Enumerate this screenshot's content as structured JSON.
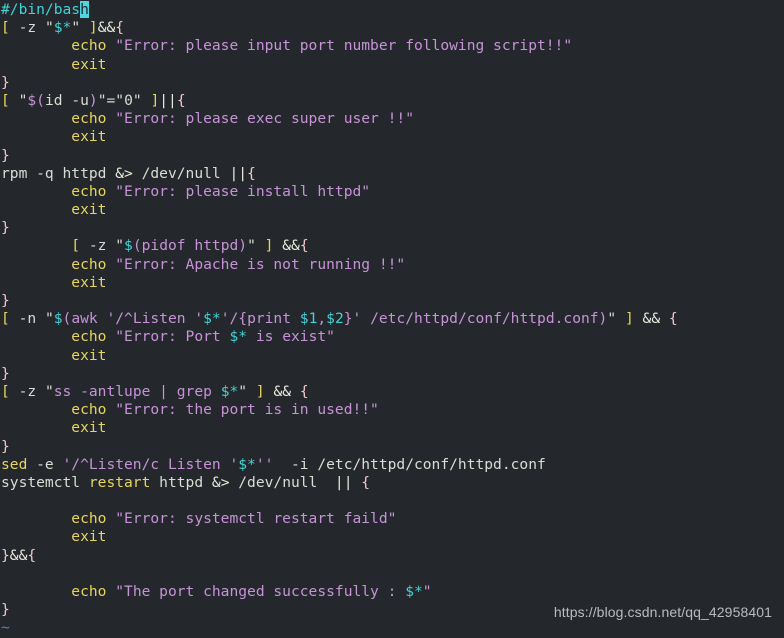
{
  "app": {
    "type": "terminal-text-editor",
    "background_color": "#24282c",
    "foreground_color": "#d8d8d2",
    "font": "monospace",
    "cursor_char": "h",
    "cursor_color": "#4fd6e0"
  },
  "palette": {
    "comment": "#3fd3d6",
    "bracket": "#e7d65b",
    "keyword": "#e7d65b",
    "string": "#c792d8",
    "variable": "#3fd3d6",
    "brace": "#f3c6c6",
    "operator": "#eceade",
    "plain": "#dcdcd4",
    "tilde": "#5a7fc4",
    "watermark": "#b9bcbe"
  },
  "watermark": {
    "text": "https://blog.csdn.net/qq_42958401"
  },
  "script": {
    "language": "bash",
    "raw_lines": [
      "#/bin/bash",
      "[ -z \"$*\" ]&&{",
      "        echo \"Error: please input port number following script!!\"",
      "        exit",
      "}",
      "[ \"$(id -u)\"=\"0\" ]||{",
      "        echo \"Error: please exec super user !!\"",
      "        exit",
      "}",
      "rpm -q httpd &> /dev/null ||{",
      "        echo \"Error: please install httpd\"",
      "        exit",
      "}",
      "        [ -z \"$(pidof httpd)\" ] &&{",
      "        echo \"Error: Apache is not running !!\"",
      "        exit",
      "}",
      "[ -n \"$(awk '/^Listen '$*'/{print $1,$2}' /etc/httpd/conf/httpd.conf)\" ] && {",
      "        echo \"Error: Port $* is exist\"",
      "        exit",
      "}",
      "[ -z \"ss -antlupe | grep $*\" ] && {",
      "        echo \"Error: the port is in used!!\"",
      "        exit",
      "}",
      "sed -e '/^Listen/c Listen '$*''  -i /etc/httpd/conf/httpd.conf",
      "systemctl restart httpd &> /dev/null  || {",
      "",
      "        echo \"Error: systemctl restart faild\"",
      "        exit",
      "}&&{",
      "",
      "        echo \"The port changed successfully : $*\"",
      "}",
      "~"
    ],
    "lines": [
      {
        "id": 1,
        "tokens": [
          {
            "t": "#/bin/bas",
            "c": "comment"
          },
          {
            "t": "h",
            "c": "cursor"
          }
        ]
      },
      {
        "id": 2,
        "tokens": [
          {
            "t": "[",
            "c": "bracket"
          },
          {
            "t": " -z ",
            "c": "plain"
          },
          {
            "t": "\"",
            "c": "quote"
          },
          {
            "t": "$*",
            "c": "var"
          },
          {
            "t": "\"",
            "c": "quote"
          },
          {
            "t": " ",
            "c": "plain"
          },
          {
            "t": "]",
            "c": "bracket"
          },
          {
            "t": "&&",
            "c": "op"
          },
          {
            "t": "{",
            "c": "brace"
          }
        ]
      },
      {
        "id": 3,
        "tokens": [
          {
            "t": "        ",
            "c": "plain"
          },
          {
            "t": "echo",
            "c": "keyword"
          },
          {
            "t": " ",
            "c": "plain"
          },
          {
            "t": "\"Error: please input port number following script!!\"",
            "c": "string"
          }
        ]
      },
      {
        "id": 4,
        "tokens": [
          {
            "t": "        ",
            "c": "plain"
          },
          {
            "t": "exit",
            "c": "keyword"
          }
        ]
      },
      {
        "id": 5,
        "tokens": [
          {
            "t": "}",
            "c": "brace"
          }
        ]
      },
      {
        "id": 6,
        "tokens": [
          {
            "t": "[",
            "c": "bracket"
          },
          {
            "t": " ",
            "c": "plain"
          },
          {
            "t": "\"",
            "c": "quote"
          },
          {
            "t": "$(",
            "c": "varm"
          },
          {
            "t": "id -u",
            "c": "plain"
          },
          {
            "t": ")",
            "c": "varm"
          },
          {
            "t": "\"",
            "c": "quote"
          },
          {
            "t": "=",
            "c": "plain"
          },
          {
            "t": "\"0\"",
            "c": "quote"
          },
          {
            "t": " ",
            "c": "plain"
          },
          {
            "t": "]",
            "c": "bracket"
          },
          {
            "t": "||",
            "c": "op"
          },
          {
            "t": "{",
            "c": "brace"
          }
        ]
      },
      {
        "id": 7,
        "tokens": [
          {
            "t": "        ",
            "c": "plain"
          },
          {
            "t": "echo",
            "c": "keyword"
          },
          {
            "t": " ",
            "c": "plain"
          },
          {
            "t": "\"Error: please exec super user !!\"",
            "c": "string"
          }
        ]
      },
      {
        "id": 8,
        "tokens": [
          {
            "t": "        ",
            "c": "plain"
          },
          {
            "t": "exit",
            "c": "keyword"
          }
        ]
      },
      {
        "id": 9,
        "tokens": [
          {
            "t": "}",
            "c": "brace"
          }
        ]
      },
      {
        "id": 10,
        "tokens": [
          {
            "t": "rpm -q httpd ",
            "c": "plain"
          },
          {
            "t": "&>",
            "c": "op"
          },
          {
            "t": " /dev/null ",
            "c": "plain"
          },
          {
            "t": "||",
            "c": "op"
          },
          {
            "t": "{",
            "c": "brace"
          }
        ]
      },
      {
        "id": 11,
        "tokens": [
          {
            "t": "        ",
            "c": "plain"
          },
          {
            "t": "echo",
            "c": "keyword"
          },
          {
            "t": " ",
            "c": "plain"
          },
          {
            "t": "\"Error: please install httpd\"",
            "c": "string"
          }
        ]
      },
      {
        "id": 12,
        "tokens": [
          {
            "t": "        ",
            "c": "plain"
          },
          {
            "t": "exit",
            "c": "keyword"
          }
        ]
      },
      {
        "id": 13,
        "tokens": [
          {
            "t": "}",
            "c": "brace"
          }
        ]
      },
      {
        "id": 14,
        "tokens": [
          {
            "t": "        ",
            "c": "plain"
          },
          {
            "t": "[",
            "c": "bracket"
          },
          {
            "t": " -z ",
            "c": "plain"
          },
          {
            "t": "\"",
            "c": "quote"
          },
          {
            "t": "$",
            "c": "var"
          },
          {
            "t": "(pidof httpd)",
            "c": "string"
          },
          {
            "t": "\"",
            "c": "quote"
          },
          {
            "t": " ",
            "c": "plain"
          },
          {
            "t": "]",
            "c": "bracket"
          },
          {
            "t": " ",
            "c": "plain"
          },
          {
            "t": "&&",
            "c": "op"
          },
          {
            "t": "{",
            "c": "brace"
          }
        ]
      },
      {
        "id": 15,
        "tokens": [
          {
            "t": "        ",
            "c": "plain"
          },
          {
            "t": "echo",
            "c": "keyword"
          },
          {
            "t": " ",
            "c": "plain"
          },
          {
            "t": "\"Error: Apache is not running !!\"",
            "c": "string"
          }
        ]
      },
      {
        "id": 16,
        "tokens": [
          {
            "t": "        ",
            "c": "plain"
          },
          {
            "t": "exit",
            "c": "keyword"
          }
        ]
      },
      {
        "id": 17,
        "tokens": [
          {
            "t": "}",
            "c": "brace"
          }
        ]
      },
      {
        "id": 18,
        "tokens": [
          {
            "t": "[",
            "c": "bracket"
          },
          {
            "t": " -n ",
            "c": "plain"
          },
          {
            "t": "\"",
            "c": "quote"
          },
          {
            "t": "$",
            "c": "var"
          },
          {
            "t": "(awk '/^Listen '",
            "c": "string"
          },
          {
            "t": "$*",
            "c": "var"
          },
          {
            "t": "'/{print ",
            "c": "string"
          },
          {
            "t": "$1",
            "c": "var"
          },
          {
            "t": ",",
            "c": "string"
          },
          {
            "t": "$2",
            "c": "var"
          },
          {
            "t": "}' /etc/httpd/conf/httpd.conf)",
            "c": "string"
          },
          {
            "t": "\"",
            "c": "quote"
          },
          {
            "t": " ",
            "c": "plain"
          },
          {
            "t": "]",
            "c": "bracket"
          },
          {
            "t": " ",
            "c": "plain"
          },
          {
            "t": "&&",
            "c": "op"
          },
          {
            "t": " ",
            "c": "plain"
          },
          {
            "t": "{",
            "c": "brace"
          }
        ]
      },
      {
        "id": 19,
        "tokens": [
          {
            "t": "        ",
            "c": "plain"
          },
          {
            "t": "echo",
            "c": "keyword"
          },
          {
            "t": " ",
            "c": "plain"
          },
          {
            "t": "\"Error: Port ",
            "c": "string"
          },
          {
            "t": "$*",
            "c": "var"
          },
          {
            "t": " is exist\"",
            "c": "string"
          }
        ]
      },
      {
        "id": 20,
        "tokens": [
          {
            "t": "        ",
            "c": "plain"
          },
          {
            "t": "exit",
            "c": "keyword"
          }
        ]
      },
      {
        "id": 21,
        "tokens": [
          {
            "t": "}",
            "c": "brace"
          }
        ]
      },
      {
        "id": 22,
        "tokens": [
          {
            "t": "[",
            "c": "bracket"
          },
          {
            "t": " -z ",
            "c": "plain"
          },
          {
            "t": "\"",
            "c": "quote"
          },
          {
            "t": "ss -antlupe | grep ",
            "c": "string"
          },
          {
            "t": "$*",
            "c": "var"
          },
          {
            "t": "\"",
            "c": "quote"
          },
          {
            "t": " ",
            "c": "plain"
          },
          {
            "t": "]",
            "c": "bracket"
          },
          {
            "t": " ",
            "c": "plain"
          },
          {
            "t": "&&",
            "c": "op"
          },
          {
            "t": " ",
            "c": "plain"
          },
          {
            "t": "{",
            "c": "brace"
          }
        ]
      },
      {
        "id": 23,
        "tokens": [
          {
            "t": "        ",
            "c": "plain"
          },
          {
            "t": "echo",
            "c": "keyword"
          },
          {
            "t": " ",
            "c": "plain"
          },
          {
            "t": "\"Error: the port is in used!!\"",
            "c": "string"
          }
        ]
      },
      {
        "id": 24,
        "tokens": [
          {
            "t": "        ",
            "c": "plain"
          },
          {
            "t": "exit",
            "c": "keyword"
          }
        ]
      },
      {
        "id": 25,
        "tokens": [
          {
            "t": "}",
            "c": "brace"
          }
        ]
      },
      {
        "id": 26,
        "tokens": [
          {
            "t": "sed",
            "c": "keyword"
          },
          {
            "t": " -e ",
            "c": "plain"
          },
          {
            "t": "'/^Listen/c Listen '",
            "c": "string"
          },
          {
            "t": "$*",
            "c": "var"
          },
          {
            "t": "''",
            "c": "string"
          },
          {
            "t": "  -i /etc/httpd/conf/httpd.conf",
            "c": "plain"
          }
        ]
      },
      {
        "id": 27,
        "tokens": [
          {
            "t": "systemctl ",
            "c": "plain"
          },
          {
            "t": "restart",
            "c": "keyword"
          },
          {
            "t": " httpd ",
            "c": "plain"
          },
          {
            "t": "&>",
            "c": "op"
          },
          {
            "t": " /dev/null  ",
            "c": "plain"
          },
          {
            "t": "||",
            "c": "op"
          },
          {
            "t": " ",
            "c": "plain"
          },
          {
            "t": "{",
            "c": "brace"
          }
        ]
      },
      {
        "id": 28,
        "tokens": [
          {
            "t": "",
            "c": "plain"
          }
        ]
      },
      {
        "id": 29,
        "tokens": [
          {
            "t": "        ",
            "c": "plain"
          },
          {
            "t": "echo",
            "c": "keyword"
          },
          {
            "t": " ",
            "c": "plain"
          },
          {
            "t": "\"Error: systemctl restart faild\"",
            "c": "string"
          }
        ]
      },
      {
        "id": 30,
        "tokens": [
          {
            "t": "        ",
            "c": "plain"
          },
          {
            "t": "exit",
            "c": "keyword"
          }
        ]
      },
      {
        "id": 31,
        "tokens": [
          {
            "t": "}",
            "c": "brace"
          },
          {
            "t": "&&",
            "c": "op"
          },
          {
            "t": "{",
            "c": "brace"
          }
        ]
      },
      {
        "id": 32,
        "tokens": [
          {
            "t": "",
            "c": "plain"
          }
        ]
      },
      {
        "id": 33,
        "tokens": [
          {
            "t": "        ",
            "c": "plain"
          },
          {
            "t": "echo",
            "c": "keyword"
          },
          {
            "t": " ",
            "c": "plain"
          },
          {
            "t": "\"The port changed successfully : ",
            "c": "string"
          },
          {
            "t": "$*",
            "c": "var"
          },
          {
            "t": "\"",
            "c": "string"
          }
        ]
      },
      {
        "id": 34,
        "tokens": [
          {
            "t": "}",
            "c": "brace"
          }
        ]
      },
      {
        "id": 35,
        "tokens": [
          {
            "t": "~",
            "c": "tilde"
          }
        ]
      }
    ]
  }
}
